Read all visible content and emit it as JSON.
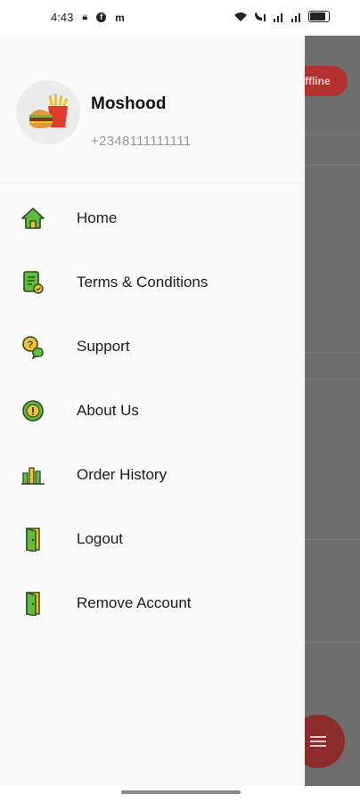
{
  "status_bar": {
    "time": "4:43",
    "left_icons": [
      "lock-icon",
      "facebook-icon",
      "m-icon"
    ],
    "right_icons": [
      "wifi-icon",
      "phone-signal-icon",
      "signal-icon",
      "signal-icon",
      "battery-icon"
    ]
  },
  "background": {
    "pill_text": "ffline"
  },
  "profile": {
    "name": "Moshood",
    "phone": "+2348111111111"
  },
  "menu": {
    "items": [
      {
        "label": "Home",
        "icon": "home-icon"
      },
      {
        "label": "Terms & Conditions",
        "icon": "document-icon"
      },
      {
        "label": "Support",
        "icon": "chat-help-icon"
      },
      {
        "label": "About Us",
        "icon": "info-icon"
      },
      {
        "label": "Order History",
        "icon": "bar-chart-icon"
      },
      {
        "label": "Logout",
        "icon": "door-icon"
      },
      {
        "label": "Remove Account",
        "icon": "door-icon"
      }
    ]
  },
  "colors": {
    "accent_green": "#5fbf3a",
    "accent_yellow": "#f2c12e",
    "icon_dark": "#2d4a1e",
    "brand_red": "#b23030"
  }
}
